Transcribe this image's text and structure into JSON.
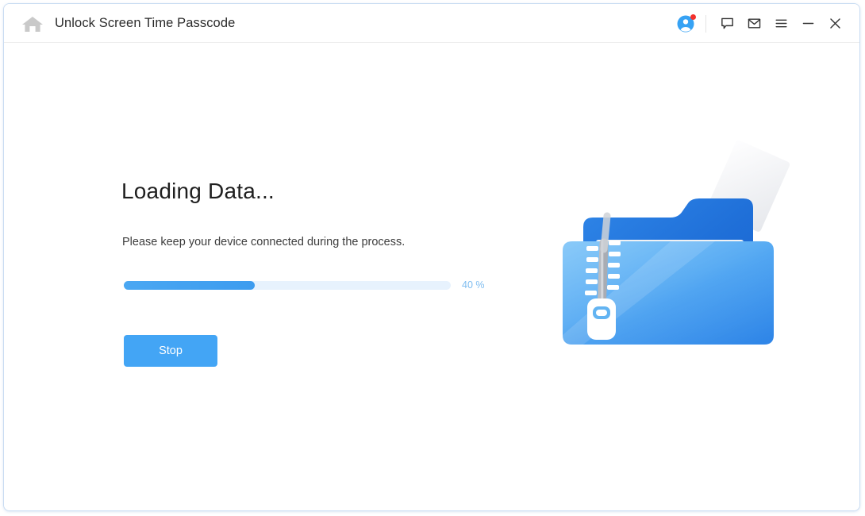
{
  "window": {
    "title": "Unlock Screen Time Passcode",
    "home_icon": "home-icon"
  },
  "titlebar": {
    "account_icon": "account-avatar-icon",
    "notification_badge": "notification-dot",
    "chat_icon": "chat-bubble-icon",
    "mail_icon": "envelope-icon",
    "menu_icon": "hamburger-menu-icon",
    "minimize_icon": "minimize-icon",
    "close_icon": "close-icon"
  },
  "main": {
    "heading": "Loading Data...",
    "subtext": "Please keep your device connected during the process.",
    "progress": {
      "percent": 40,
      "label": "40 %"
    },
    "stop_label": "Stop",
    "illustration_name": "zipped-folder-illustration"
  },
  "colors": {
    "accent": "#43a5f5",
    "progress_fill": "#3d9cef",
    "progress_track": "#e7f2fd",
    "progress_text": "#7fbdf0",
    "badge_red": "#f4312c",
    "title_text": "#2b2b2b",
    "window_border": "#c9dcf2"
  }
}
